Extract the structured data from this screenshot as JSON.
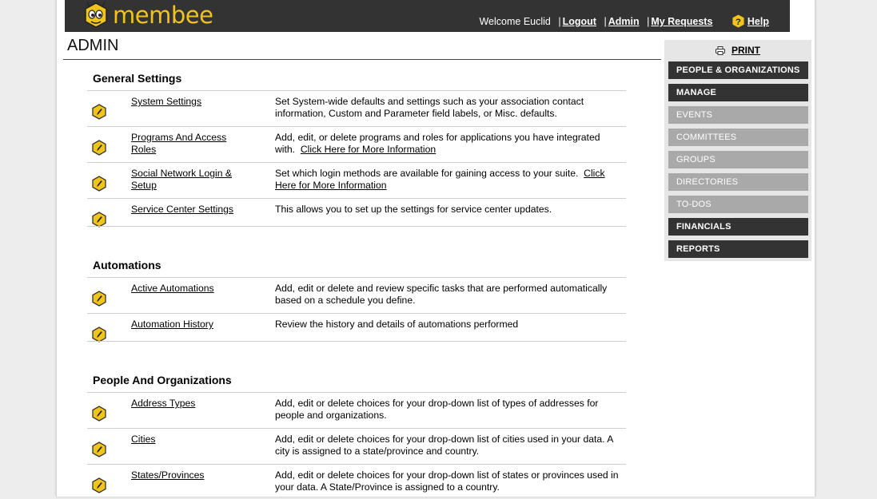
{
  "brand": {
    "name": "membee"
  },
  "header": {
    "welcome": "Welcome Euclid",
    "logout": "Logout",
    "admin": "Admin",
    "my_requests": "My Requests",
    "help": "Help",
    "sep": "|"
  },
  "page_title": "ADMIN",
  "sections": {
    "general": {
      "heading": "General Settings",
      "items": [
        {
          "link": "System Settings",
          "desc": "Set System-wide defaults and settings such as your association contact information, Custom and Parameter field labels, or Misc. defaults."
        },
        {
          "link": "Programs And Access Roles",
          "desc": "Add, edit, or delete programs and roles for applications you have integrated with.",
          "more": "Click Here for More Information"
        },
        {
          "link": "Social Network Login & Setup",
          "desc": "Set which login methods are available for gaining access to your suite.",
          "more": "Click Here for More Information"
        },
        {
          "link": "Service Center Settings",
          "desc": "This allows you to set up the settings for service center updates."
        }
      ]
    },
    "automations": {
      "heading": "Automations",
      "items": [
        {
          "link": "Active Automations",
          "desc": "Add, edit or delete and review specific tasks that are performed automatically based on a schedule you define."
        },
        {
          "link": "Automation History",
          "desc": "Review the history and details of automations performed"
        }
      ]
    },
    "people": {
      "heading": "People And Organizations",
      "items": [
        {
          "link": "Address Types",
          "desc": "Add, edit or delete choices for your drop-down list of types of addresses for people and organizations."
        },
        {
          "link": "Cities",
          "desc": "Add, edit or delete choices for your drop-down list of cities used in your data. A city is assigned to a state/province and country."
        },
        {
          "link": "States/Provinces",
          "desc": "Add, edit or delete choices for your drop-down list of states or provinces used in your data. A State/Province is assigned to a country."
        }
      ]
    }
  },
  "sidebar": {
    "print": "PRINT",
    "items": [
      {
        "label": "PEOPLE & ORGANIZATIONS",
        "style": "dark"
      },
      {
        "label": "MANAGE",
        "style": "dark"
      },
      {
        "label": "EVENTS",
        "style": "light"
      },
      {
        "label": "COMMITTEES",
        "style": "light"
      },
      {
        "label": "GROUPS",
        "style": "light"
      },
      {
        "label": "DIRECTORIES",
        "style": "light"
      },
      {
        "label": "TO-DOS",
        "style": "light"
      },
      {
        "label": "FINANCIALS",
        "style": "dark"
      },
      {
        "label": "REPORTS",
        "style": "dark"
      }
    ]
  },
  "icons": {
    "logo": "bee-logo-icon",
    "help": "question-hexagon-icon",
    "row": "pencil-hexagon-icon",
    "print": "printer-icon"
  },
  "colors": {
    "header_bg": "#333333",
    "brand_yellow": "#f0c419",
    "menu_dark": "#333333",
    "menu_light": "#a9a9a9",
    "sidebar_bg": "#e6e6e6"
  }
}
